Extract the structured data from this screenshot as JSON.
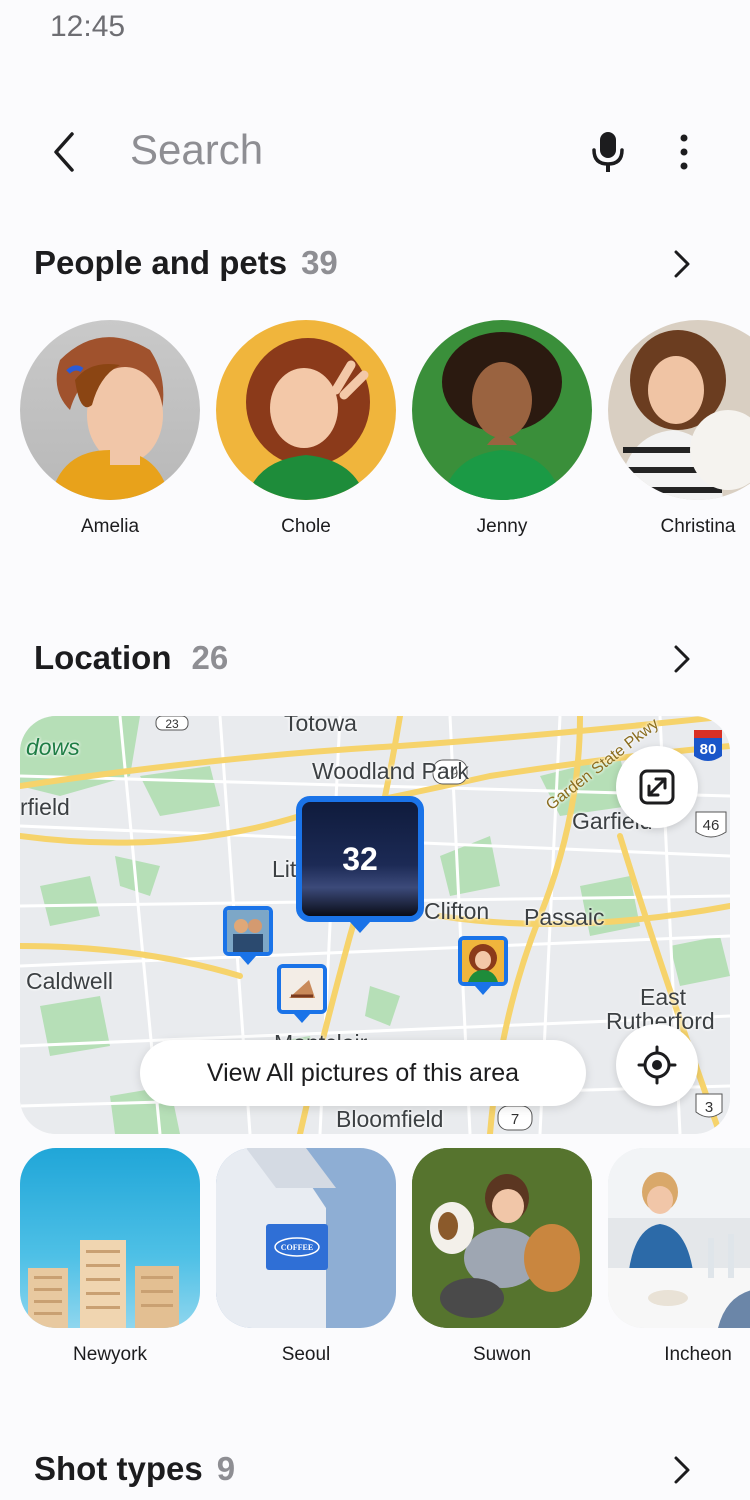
{
  "status": {
    "time": "12:45"
  },
  "search": {
    "placeholder": "Search"
  },
  "people_section": {
    "title": "People and pets",
    "count": "39",
    "people": [
      {
        "name": "Amelia"
      },
      {
        "name": "Chole"
      },
      {
        "name": "Jenny"
      },
      {
        "name": "Christina"
      }
    ]
  },
  "location_section": {
    "title": "Location",
    "count": "26",
    "map": {
      "labels": [
        "Totowa",
        "Woodland Park",
        "Garfield",
        "Clifton",
        "Passaic",
        "Caldwell",
        "East",
        "Rutherford",
        "Montclair",
        "Bloomfield",
        "dows",
        "rfield",
        "Lit",
        "Garden State Pkwy"
      ],
      "road_shields": [
        "19",
        "80",
        "46",
        "7",
        "3",
        "23"
      ],
      "cluster_count": "32",
      "view_all_label": "View All pictures of this area"
    },
    "places": [
      {
        "name": "Newyork"
      },
      {
        "name": "Seoul"
      },
      {
        "name": "Suwon"
      },
      {
        "name": "Incheon"
      }
    ],
    "coffee_sign": "COFFEE"
  },
  "shot_types_section": {
    "title": "Shot types",
    "count": "9"
  },
  "icons": {
    "back": "chevron-left-icon",
    "mic": "microphone-icon",
    "more": "more-vertical-icon",
    "expand": "expand-icon",
    "locate": "locate-icon"
  },
  "colors": {
    "accent": "#1a73e8",
    "background": "#fbfbfd",
    "muted": "#8e8e93"
  }
}
